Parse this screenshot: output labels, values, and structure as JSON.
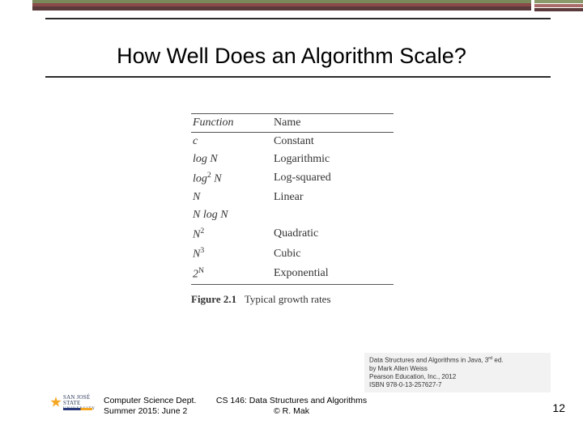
{
  "title": "How Well Does an Algorithm Scale?",
  "table": {
    "head_func": "Function",
    "head_name": "Name",
    "rows": [
      {
        "func_html": "c",
        "name": "Constant"
      },
      {
        "func_html": "log N",
        "name": "Logarithmic"
      },
      {
        "func_html": "log<sup>2</sup> N",
        "name": "Log-squared"
      },
      {
        "func_html": "N",
        "name": "Linear"
      },
      {
        "func_html": "N log N",
        "name": ""
      },
      {
        "func_html": "N<sup>2</sup>",
        "name": "Quadratic"
      },
      {
        "func_html": "N<sup>3</sup>",
        "name": "Cubic"
      },
      {
        "func_html": "2<sup>N</sup>",
        "name": "Exponential"
      }
    ],
    "caption_label": "Figure 2.1",
    "caption_text": "Typical growth rates"
  },
  "citation": {
    "line1_a": "Data Structures and Algorithms in Java, 3",
    "line1_b": " ed.",
    "line2": "by Mark Allen Weiss",
    "line3": "Pearson Education, Inc., 2012",
    "line4": "ISBN 978-0-13-257627-7"
  },
  "footer": {
    "dept": "Computer Science Dept.",
    "term": "Summer 2015: June 2",
    "course": "CS 146: Data Structures and Algorithms",
    "author": "© R. Mak",
    "slide": "12",
    "logo_line1": "SAN JOSÉ STATE",
    "logo_line2": "UNIVERSITY"
  }
}
